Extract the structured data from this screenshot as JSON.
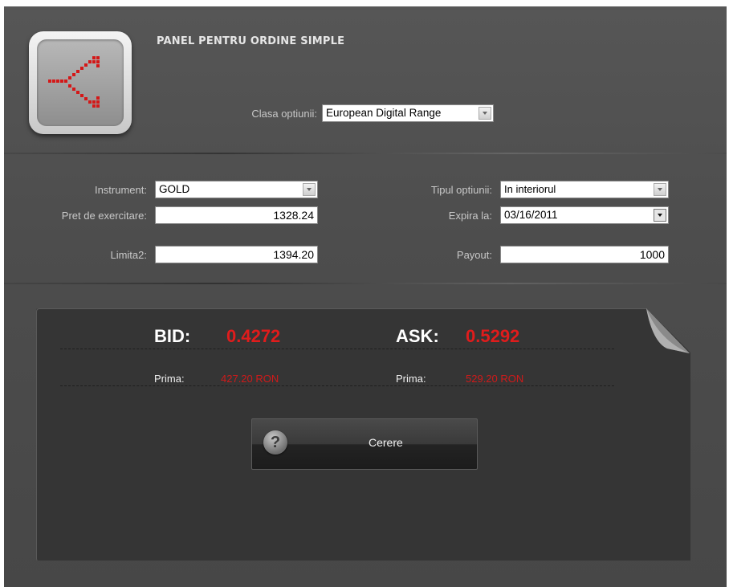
{
  "header": {
    "title": "PANEL PENTRU ORDINE SIMPLE",
    "option_class_label": "Clasa optiunii:",
    "option_class_value": "European Digital Range"
  },
  "form": {
    "instrument_label": "Instrument:",
    "instrument_value": "GOLD",
    "strike_label": "Pret de exercitare:",
    "strike_value": "1328.24",
    "limit2_label": "Limita2:",
    "limit2_value": "1394.20",
    "option_type_label": "Tipul optiunii:",
    "option_type_value": "In interiorul",
    "expiry_label": "Expira la:",
    "expiry_value": "03/16/2011",
    "payout_label": "Payout:",
    "payout_value": "1000"
  },
  "quote": {
    "bid_label": "BID:",
    "bid_value": "0.4272",
    "ask_label": "ASK:",
    "ask_value": "0.5292",
    "bid_prima_label": "Prima:",
    "bid_prima_value": "427.20 RON",
    "ask_prima_label": "Prima:",
    "ask_prima_value": "529.20 RON"
  },
  "actions": {
    "request_label": "Cerere",
    "help_glyph": "?"
  },
  "colors": {
    "accent_red": "#e01c1c",
    "panel_bg": "#4d4d4d",
    "card_bg": "#353535"
  },
  "icons": {
    "logo": "split-arrows-icon",
    "help": "help-icon"
  }
}
